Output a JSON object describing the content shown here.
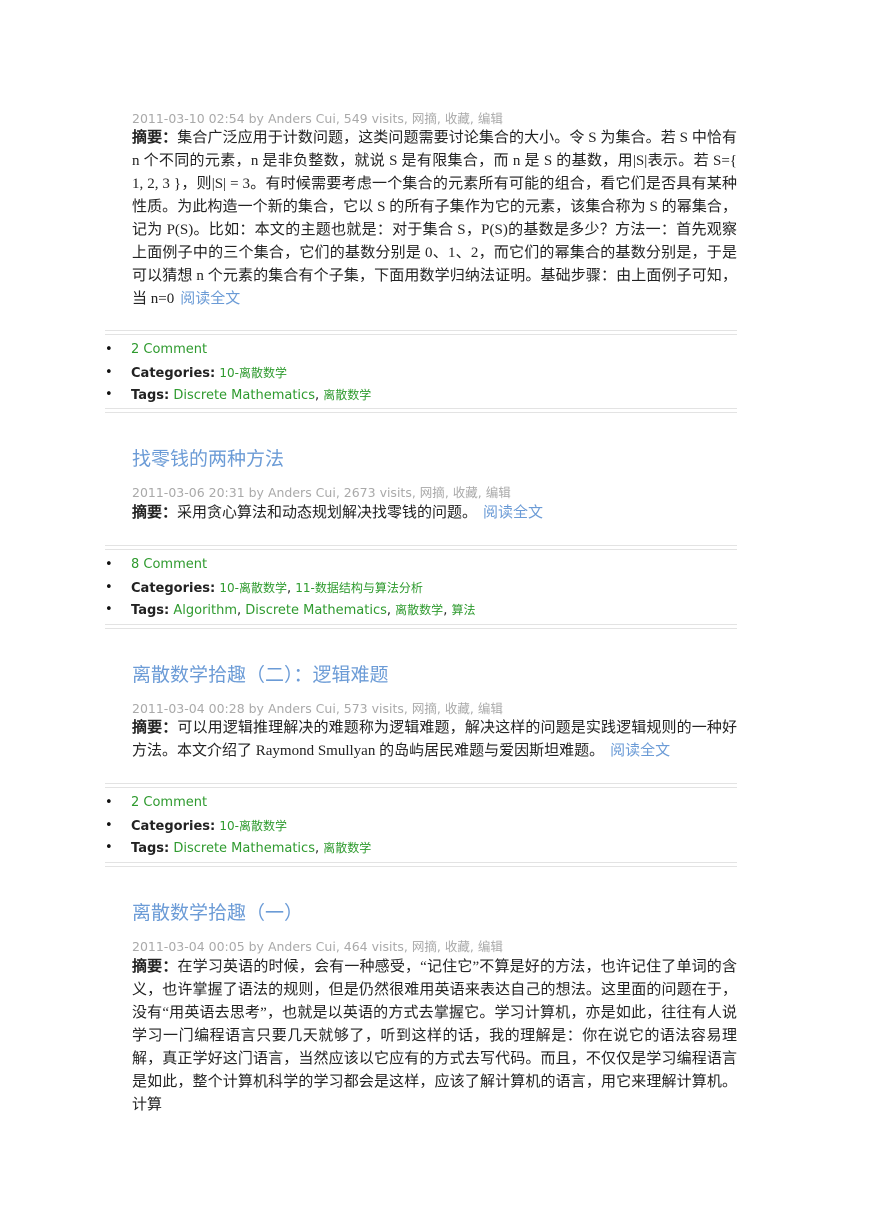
{
  "posts": [
    {
      "title": "",
      "meta": {
        "date": "2011-03-10 02:54",
        "by": "by",
        "author": "Anders Cui",
        "visits": "549 visits,",
        "actions": [
          "网摘",
          "收藏",
          "编辑"
        ]
      },
      "summary_label": "摘要：",
      "summary": "集合广泛应用于计数问题，这类问题需要讨论集合的大小。令 S 为集合。若 S 中恰有 n 个不同的元素，n 是非负整数，就说 S 是有限集合，而 n 是 S 的基数，用|S|表示。若 S={ 1, 2, 3 }，则|S| = 3。有时候需要考虑一个集合的元素所有可能的组合，看它们是否具有某种性质。为此构造一个新的集合，它以 S 的所有子集作为它的元素，该集合称为 S 的幂集合，记为 P(S)。比如：本文的主题也就是：对于集合 S，P(S)的基数是多少？方法一：首先观察上面例子中的三个集合，它们的基数分别是 0、1、2，而它们的幂集合的基数分别是，于是可以猜想 n 个元素的集合有个子集，下面用数学归纳法证明。基础步骤：由上面例子可知，当 n=0",
      "read_more": "阅读全文",
      "comments": "2 Comment",
      "categories_label": "Categories:",
      "categories": [
        "10-离散数学"
      ],
      "tags_label": "Tags:",
      "tags": [
        "Discrete Mathematics",
        "离散数学"
      ]
    },
    {
      "title": "找零钱的两种方法",
      "meta": {
        "date": "2011-03-06 20:31",
        "by": "by",
        "author": "Anders Cui",
        "visits": "2673 visits,",
        "actions": [
          "网摘",
          "收藏",
          "编辑"
        ]
      },
      "summary_label": "摘要：",
      "summary": "采用贪心算法和动态规划解决找零钱的问题。",
      "read_more": "阅读全文",
      "comments": "8 Comment",
      "categories_label": "Categories:",
      "categories": [
        "10-离散数学",
        "11-数据结构与算法分析"
      ],
      "tags_label": "Tags:",
      "tags": [
        "Algorithm",
        "Discrete Mathematics",
        "离散数学",
        "算法"
      ]
    },
    {
      "title": "离散数学拾趣（二）：逻辑难题",
      "meta": {
        "date": "2011-03-04 00:28",
        "by": "by",
        "author": "Anders Cui",
        "visits": "573 visits,",
        "actions": [
          "网摘",
          "收藏",
          "编辑"
        ]
      },
      "summary_label": "摘要：",
      "summary": "可以用逻辑推理解决的难题称为逻辑难题，解决这样的问题是实践逻辑规则的一种好方法。本文介绍了 Raymond Smullyan 的岛屿居民难题与爱因斯坦难题。",
      "read_more": "阅读全文",
      "comments": "2 Comment",
      "categories_label": "Categories:",
      "categories": [
        "10-离散数学"
      ],
      "tags_label": "Tags:",
      "tags": [
        "Discrete Mathematics",
        "离散数学"
      ]
    },
    {
      "title": "离散数学拾趣（一）",
      "meta": {
        "date": "2011-03-04 00:05",
        "by": "by",
        "author": "Anders Cui",
        "visits": "464 visits,",
        "actions": [
          "网摘",
          "收藏",
          "编辑"
        ]
      },
      "summary_label": "摘要：",
      "summary": "在学习英语的时候，会有一种感受，“记住它”不算是好的方法，也许记住了单词的含义，也许掌握了语法的规则，但是仍然很难用英语来表达自己的想法。这里面的问题在于，没有“用英语去思考”，也就是以英语的方式去掌握它。学习计算机，亦是如此，往往有人说学习一门编程语言只要几天就够了，听到这样的话，我的理解是：你在说它的语法容易理解，真正学好这门语言，当然应该以它应有的方式去写代码。而且，不仅仅是学习编程语言是如此，整个计算机科学的学习都会是这样，应该了解计算机的语言，用它来理解计算机。计算"
    }
  ]
}
